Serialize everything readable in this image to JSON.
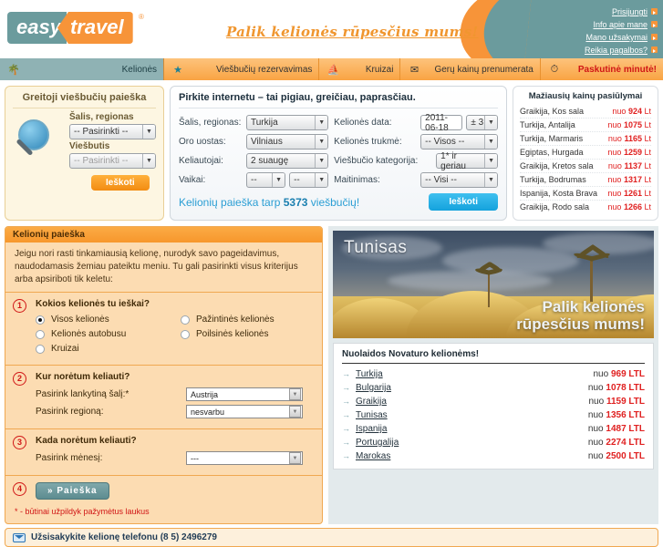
{
  "header": {
    "logo_part1": "easy",
    "logo_part2": "travel",
    "logo_reg": "®",
    "slogan": "Palik kelionės rūpesčius mums!",
    "links": [
      {
        "label": "Prisijungti"
      },
      {
        "label": "Info apie mane"
      },
      {
        "label": "Mano užsakymai"
      },
      {
        "label": "Reikia pagalbos?"
      }
    ]
  },
  "nav": {
    "active_tab": "Kelionės",
    "active_icon": "palm-tree-icon",
    "items": [
      {
        "label": "Viešbučių rezervavimas",
        "icon": "star-icon"
      },
      {
        "label": "Kruizai",
        "icon": "ship-icon"
      },
      {
        "label": "Gerų kainų prenumerata",
        "icon": "envelope-icon"
      },
      {
        "label": "Paskutinė minutė!",
        "icon": "clock-icon"
      }
    ]
  },
  "quick_hotel_search": {
    "title": "Greitoji viešbučių paieška",
    "country_label": "Šalis, regionas",
    "country_value": "-- Pasirinkti --",
    "hotel_label": "Viešbutis",
    "hotel_value": "-- Pasirinkti --",
    "button": "Ieškoti"
  },
  "main_search": {
    "title": "Pirkite internetu – tai pigiau, greičiau, paprasčiau.",
    "fields": {
      "country_label": "Šalis, regionas:",
      "country_value": "Turkija",
      "airport_label": "Oro uostas:",
      "airport_value": "Vilniaus",
      "travellers_label": "Keliautojai:",
      "travellers_value": "2 suaugę",
      "children_label": "Vaikai:",
      "child1_value": "--",
      "child2_value": "--",
      "date_label": "Kelionės data:",
      "date_value": "2011-06-18",
      "date_range_value": "± 3",
      "duration_label": "Kelionės trukmė:",
      "duration_value": "-- Visos --",
      "category_label": "Viešbučio kategorija:",
      "category_value": "1* ir geriau",
      "board_label": "Maitinimas:",
      "board_value": "-- Visi --"
    },
    "footer_text_pre": "Kelionių paieška tarp ",
    "footer_count": "5373",
    "footer_text_post": " viešbučių!",
    "button": "Ieškoti"
  },
  "cheapest": {
    "title": "Mažiausių kainų pasiūlymai",
    "rows": [
      {
        "dest": "Graikija, Kos sala",
        "from": "nuo",
        "price": "924",
        "cur": "Lt"
      },
      {
        "dest": "Turkija, Antalija",
        "from": "nuo",
        "price": "1075",
        "cur": "Lt"
      },
      {
        "dest": "Turkija, Marmaris",
        "from": "nuo",
        "price": "1165",
        "cur": "Lt"
      },
      {
        "dest": "Egiptas, Hurgada",
        "from": "nuo",
        "price": "1259",
        "cur": "Lt"
      },
      {
        "dest": "Graikija, Kretos sala",
        "from": "nuo",
        "price": "1137",
        "cur": "Lt"
      },
      {
        "dest": "Turkija, Bodrumas",
        "from": "nuo",
        "price": "1317",
        "cur": "Lt"
      },
      {
        "dest": "Ispanija, Kosta Brava",
        "from": "nuo",
        "price": "1261",
        "cur": "Lt"
      },
      {
        "dest": "Graikija, Rodo sala",
        "from": "nuo",
        "price": "1266",
        "cur": "Lt"
      }
    ]
  },
  "trip_search": {
    "head": "Kelionių paieška",
    "intro": "Jeigu nori rasti tinkamiausią kelionę, nurodyk savo pageidavimus, naudodamasis žemiau pateiktu meniu. Tu gali pasirinkti visus kriterijus arba apsiriboti tik keletu:",
    "step1": {
      "num": "1",
      "title": "Kokios kelionės tu ieškai?",
      "options_left": [
        {
          "label": "Visos kelionės",
          "selected": true
        },
        {
          "label": "Kelionės autobusu",
          "selected": false
        },
        {
          "label": "Kruizai",
          "selected": false
        }
      ],
      "options_right": [
        {
          "label": "Pažintinės kelionės",
          "selected": false
        },
        {
          "label": "Poilsinės kelionės",
          "selected": false
        }
      ]
    },
    "step2": {
      "num": "2",
      "title": "Kur norėtum keliauti?",
      "country_label": "Pasirink lankytiną šalį:*",
      "country_value": "Austrija",
      "region_label": "Pasirink regioną:",
      "region_value": "nesvarbu"
    },
    "step3": {
      "num": "3",
      "title": "Kada norėtum keliauti?",
      "month_label": "Pasirink mėnesį:",
      "month_value": "---"
    },
    "step4": {
      "num": "4",
      "button": "» Paieška"
    },
    "note": "* - būtinai užpildyk pažymėtus laukus"
  },
  "banner": {
    "title": "Tunisas",
    "slogan_line1": "Palik kelionės",
    "slogan_line2": "rūpesčius mums!"
  },
  "offers": {
    "title": "Nuolaidos Novaturo kelionėms!",
    "rows": [
      {
        "dest": "Turkija",
        "from": "nuo",
        "price": "969 LTL"
      },
      {
        "dest": "Bulgarija",
        "from": "nuo",
        "price": "1078 LTL"
      },
      {
        "dest": "Graikija",
        "from": "nuo",
        "price": "1159 LTL"
      },
      {
        "dest": "Tunisas",
        "from": "nuo",
        "price": "1356 LTL"
      },
      {
        "dest": "Ispanija",
        "from": "nuo",
        "price": "1487 LTL"
      },
      {
        "dest": "Portugalija",
        "from": "nuo",
        "price": "2274 LTL"
      },
      {
        "dest": "Marokas",
        "from": "nuo",
        "price": "2500 LTL"
      }
    ]
  },
  "footer": {
    "phone_text": "Užsisakykite kelionę telefonu (8 5) 2496279"
  },
  "colors": {
    "teal": "#6b9b9d",
    "orange": "#f79439",
    "red": "#d01616",
    "blue": "#14a2dd"
  }
}
